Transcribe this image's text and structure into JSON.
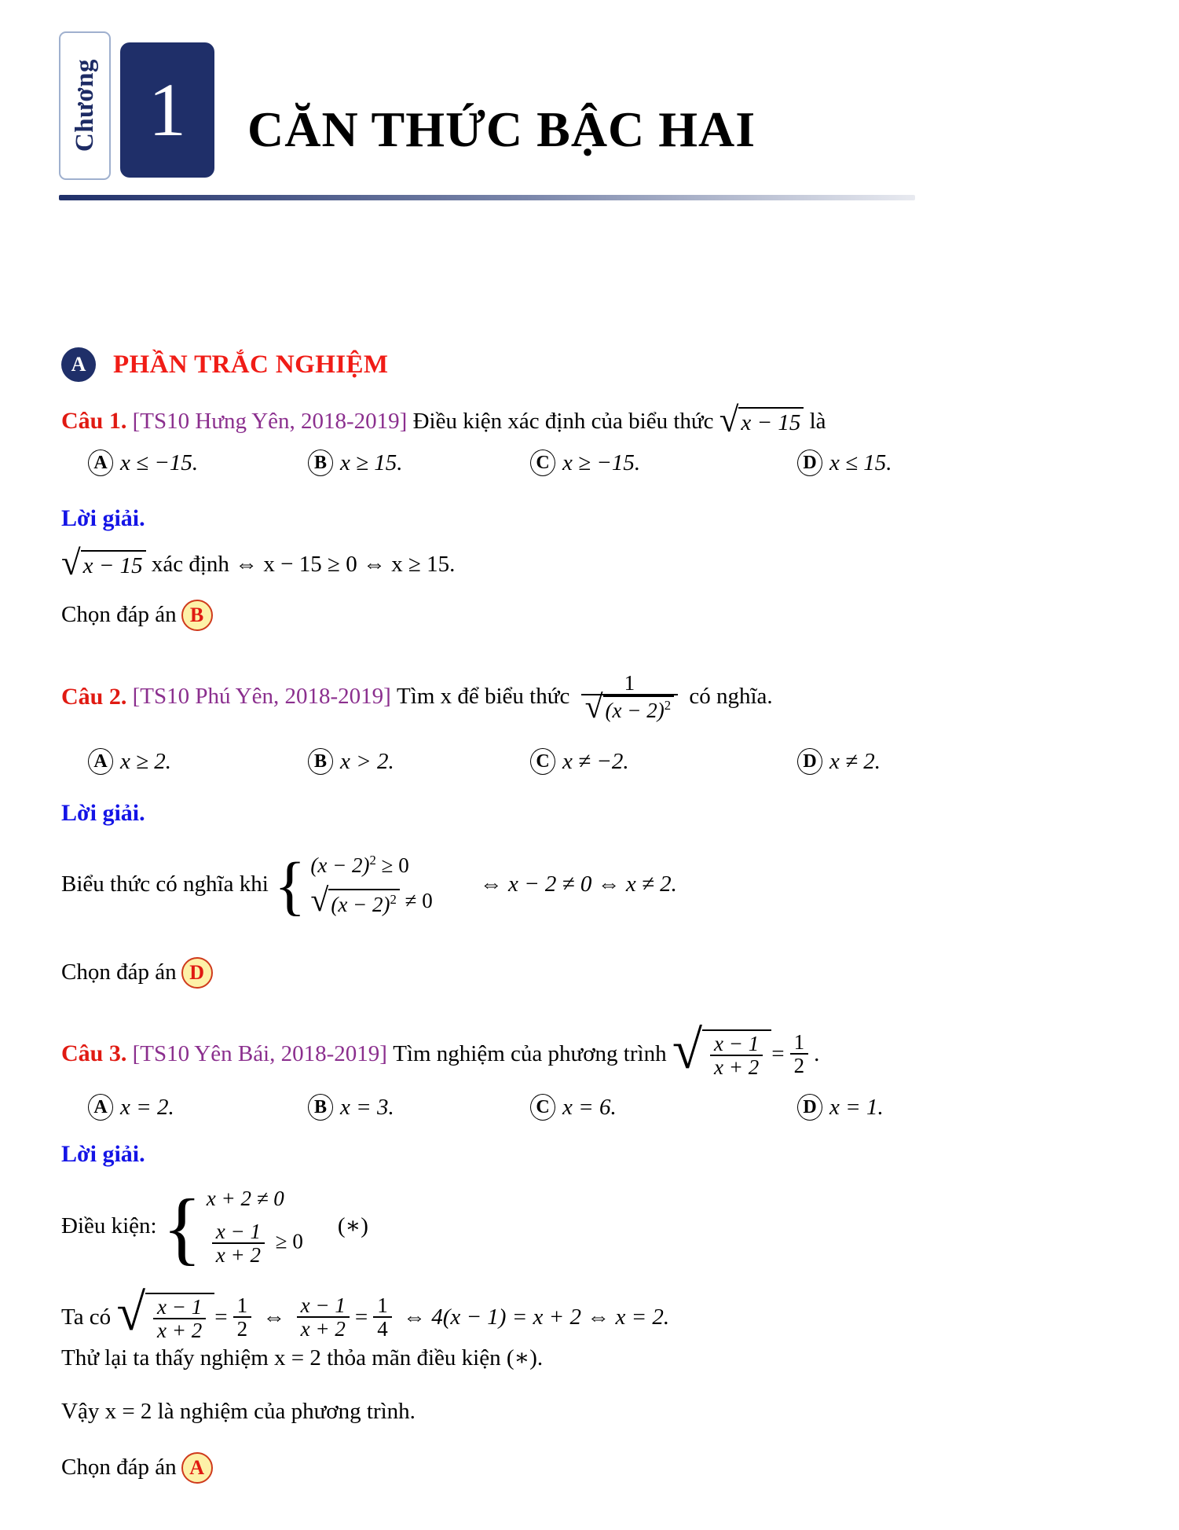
{
  "chapter": {
    "kicker": "Chương",
    "number": "1",
    "title": "CĂN THỨC BẬC HAI"
  },
  "section": {
    "badge": "A",
    "title": "PHẦN TRẮC NGHIỆM"
  },
  "labels": {
    "loigiai": "Lời giải.",
    "chon_dap_an": "Chọn đáp án"
  },
  "questions": [
    {
      "label": "Câu 1.",
      "source": "[TS10 Hưng Yên, 2018-2019]",
      "prompt_pre": "Điều kiện xác định của biểu thức",
      "radicand": "x − 15",
      "prompt_post": "là",
      "choices": [
        {
          "letter": "A",
          "text": "x ≤ −15."
        },
        {
          "letter": "B",
          "text": "x ≥ 15."
        },
        {
          "letter": "C",
          "text": "x ≥ −15."
        },
        {
          "letter": "D",
          "text": "x ≤ 15."
        }
      ],
      "solution_line": "xác định ⇔ x − 15 ≥ 0 ⇔ x ≥ 15.",
      "solution_radicand": "x − 15",
      "answer": "B"
    },
    {
      "label": "Câu 2.",
      "source": "[TS10 Phú Yên, 2018-2019]",
      "prompt_pre": "Tìm x để biểu thức",
      "frac_num": "1",
      "frac_den_radicand": "(x − 2)",
      "frac_den_exp": "2",
      "prompt_post": "có nghĩa.",
      "choices": [
        {
          "letter": "A",
          "text": "x ≥ 2."
        },
        {
          "letter": "B",
          "text": "x > 2."
        },
        {
          "letter": "C",
          "text": "x ≠ −2."
        },
        {
          "letter": "D",
          "text": "x ≠ 2."
        }
      ],
      "solution_intro": "Biểu thức có nghĩa khi",
      "system_row1_base": "(x − 2)",
      "system_row1_exp": "2",
      "system_row1_tail": "≥ 0",
      "system_row2_base": "(x − 2)",
      "system_row2_exp": "2",
      "system_row2_tail": "≠ 0",
      "solution_tail": "⇔ x − 2 ≠ 0 ⇔ x ≠ 2.",
      "answer": "D"
    },
    {
      "label": "Câu 3.",
      "source": "[TS10 Yên Bái, 2018-2019]",
      "prompt_pre": "Tìm nghiệm của phương trình",
      "eq_num": "x − 1",
      "eq_den": "x + 2",
      "eq_rhs_num": "1",
      "eq_rhs_den": "2",
      "prompt_post": ".",
      "choices": [
        {
          "letter": "A",
          "text": "x = 2."
        },
        {
          "letter": "B",
          "text": "x = 3."
        },
        {
          "letter": "C",
          "text": "x = 6."
        },
        {
          "letter": "D",
          "text": "x = 1."
        }
      ],
      "cond_label": "Điều kiện:",
      "cond_row1": "x + 2 ≠ 0",
      "cond_row2_num": "x − 1",
      "cond_row2_den": "x + 2",
      "cond_row2_tail": "≥ 0",
      "cond_star": "(∗)",
      "work_intro": "Ta có",
      "work_f1_num": "x − 1",
      "work_f1_den": "x + 2",
      "work_eq1_num": "1",
      "work_eq1_den": "2",
      "work_mid": "⇔",
      "work_f2_num": "x − 1",
      "work_f2_den": "x + 2",
      "work_eq2_num": "1",
      "work_eq2_den": "4",
      "work_tail": "⇔ 4(x − 1) = x + 2 ⇔ x = 2.",
      "check_line": "Thử lại ta thấy nghiệm x = 2 thỏa mãn điều kiện (∗).",
      "conclusion": "Vậy x = 2 là nghiệm của phương trình.",
      "answer": "A"
    }
  ],
  "colors": {
    "navy": "#1f2f69",
    "red": "#e01a12",
    "purple": "#8b2f8e",
    "blue": "#1414e6",
    "bubble_fill": "#fdf1a8",
    "bubble_border": "#cf3a1c"
  }
}
